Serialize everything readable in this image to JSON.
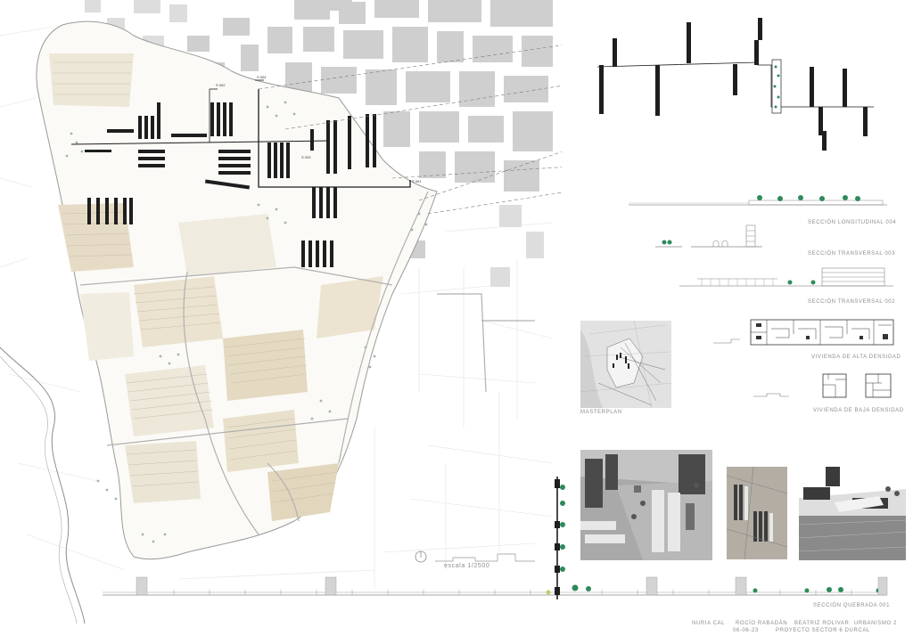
{
  "labels": {
    "section_004": "SECCIÓN LONGITUDINAL 004",
    "section_003": "SECCIÓN TRANSVERSAL 003",
    "section_002": "SECCIÓN TRANSVERSAL 002",
    "high_density": "VIVIENDA DE ALTA DENSIDAD",
    "low_density": "VIVIENDA DE BAJA DENSIDAD",
    "masterplan": "MASTERPLAN",
    "scale": "escala 1/2500",
    "section_001": "SECCIÓN QUEBRADA 001"
  },
  "map_tags": {
    "s002": "S 002",
    "s004": "S 004",
    "s003": "S 003",
    "s001": "S 001"
  },
  "footer": {
    "authors": [
      "NURIA CAL",
      "ROCÍO RABADÁN",
      "BEATRIZ ROLIVAR"
    ],
    "course": "URBANISMO 2",
    "date": "06-06-23",
    "project": "PROYECTO SECTOR 6 DURCAL"
  },
  "colors": {
    "block": "#1e1e1e",
    "urban": "#cfcfcf",
    "crops": "#d9cdb5",
    "tree": "#2f8a5c",
    "line": "#9a9a9a"
  }
}
